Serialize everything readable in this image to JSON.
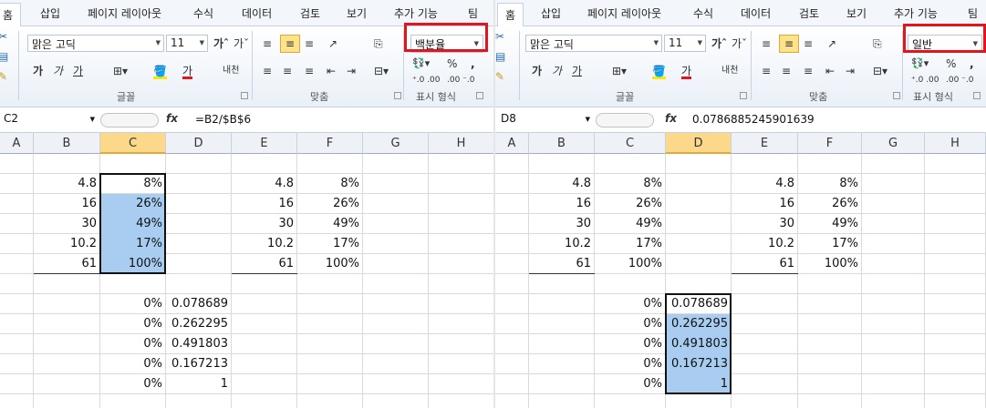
{
  "left": {
    "tabs": [
      "홈",
      "삽입",
      "페이지 레이아웃",
      "수식",
      "데이터",
      "검토",
      "보기",
      "추가 기능",
      "팀"
    ],
    "font_name": "맑은 고딕",
    "font_size": "11",
    "format_buttons": [
      "가",
      "가",
      "가"
    ],
    "group_font_label": "글꼴",
    "group_align_label": "맞춤",
    "group_number_label": "표시 형식",
    "number_format": "백분율",
    "name_box": "C2",
    "formula": "=B2/$B$6",
    "col_headers": [
      "A",
      "B",
      "C",
      "D",
      "E",
      "F",
      "G",
      "H"
    ],
    "rows": [
      [
        "",
        "",
        "",
        "",
        "",
        "",
        ""
      ],
      [
        "4.8",
        "8%",
        "",
        "4.8",
        "8%"
      ],
      [
        "16",
        "26%",
        "",
        "16",
        "26%"
      ],
      [
        "30",
        "49%",
        "",
        "30",
        "49%"
      ],
      [
        "10.2",
        "17%",
        "",
        "10.2",
        "17%"
      ],
      [
        "61",
        "100%",
        "",
        "61",
        "100%"
      ],
      [
        "",
        "",
        "",
        "",
        ""
      ],
      [
        "",
        "0%",
        "0.078689",
        "",
        ""
      ],
      [
        "",
        "0%",
        "0.262295",
        "",
        ""
      ],
      [
        "",
        "0%",
        "0.491803",
        "",
        ""
      ],
      [
        "",
        "0%",
        "0.167213",
        "",
        ""
      ],
      [
        "",
        "0%",
        "1",
        "",
        ""
      ]
    ]
  },
  "right": {
    "tabs": [
      "홈",
      "삽입",
      "페이지 레이아웃",
      "수식",
      "데이터",
      "검토",
      "보기",
      "추가 기능",
      "팀"
    ],
    "font_name": "맑은 고딕",
    "font_size": "11",
    "number_format": "일반",
    "group_font_label": "글꼴",
    "group_align_label": "맞춤",
    "group_number_label": "표시 형식",
    "name_box": "D8",
    "formula": "0.0786885245901639",
    "col_headers": [
      "A",
      "B",
      "C",
      "D",
      "E",
      "F",
      "G",
      "H"
    ],
    "rows": [
      [
        "",
        "",
        "",
        "",
        ""
      ],
      [
        "4.8",
        "8%",
        "",
        "4.8",
        "8%"
      ],
      [
        "16",
        "26%",
        "",
        "16",
        "26%"
      ],
      [
        "30",
        "49%",
        "",
        "30",
        "49%"
      ],
      [
        "10.2",
        "17%",
        "",
        "10.2",
        "17%"
      ],
      [
        "61",
        "100%",
        "",
        "61",
        "100%"
      ],
      [
        "",
        "",
        "",
        "",
        ""
      ],
      [
        "",
        "0%",
        "0.078689",
        "",
        ""
      ],
      [
        "",
        "0%",
        "0.262295",
        "",
        ""
      ],
      [
        "",
        "0%",
        "0.491803",
        "",
        ""
      ],
      [
        "",
        "0%",
        "0.167213",
        "",
        ""
      ],
      [
        "",
        "0%",
        "1",
        "",
        ""
      ]
    ]
  },
  "icons": {
    "currency": "💱",
    "percent": "%",
    "comma": ",",
    "wrap": "내쳐"
  },
  "colors": {
    "highlight": "#a8cdf0",
    "redbox": "#e3141c",
    "active_header": "#fbd88a"
  }
}
